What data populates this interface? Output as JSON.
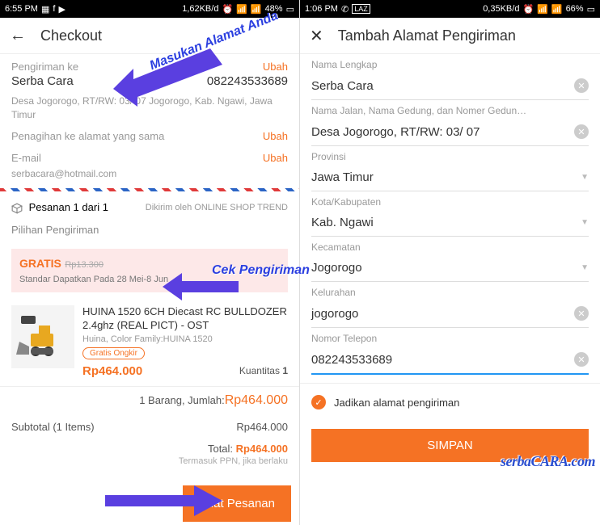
{
  "left": {
    "status": {
      "time": "6:55 PM",
      "net": "1,62KB/d",
      "batt": "48%"
    },
    "title": "Checkout",
    "ship_to_label": "Pengiriman ke",
    "ubah": "Ubah",
    "name": "Serba Cara",
    "phone": "082243533689",
    "address": "Desa Jogorogo, RT/RW: 03/ 07 Jogorogo, Kab. Ngawi, Jawa Timur",
    "billing_label": "Penagihan ke alamat yang sama",
    "email_label": "E-mail",
    "email": "serbacara@hotmail.com",
    "order_label": "Pesanan 1 dari 1",
    "shipped_by": "Dikirim oleh ONLINE SHOP TREND",
    "ship_option_label": "Pilihan Pengiriman",
    "free": "GRATIS",
    "free_strike": "Rp13.300",
    "ship_sub": "Standar  Dapatkan Pada 28 Mei-8 Jun",
    "product": {
      "title": "HUINA 1520 6CH Diecast RC BULLDOZER 2.4ghz (REAL PICT) - OST",
      "meta": "Huina, Color Family:HUINA 1520",
      "badge": "Gratis Ongkir",
      "price": "Rp464.000",
      "qty_label": "Kuantitas",
      "qty": "1"
    },
    "sum_label": "1 Barang, Jumlah:",
    "sum_amt": "Rp464.000",
    "subtotal_label": "Subtotal  (1 Items)",
    "subtotal": "Rp464.000",
    "total_label": "Total:",
    "total": "Rp464.000",
    "ppn": "Termasuk PPN, jika berlaku",
    "cta": "Buat Pesanan"
  },
  "right": {
    "status": {
      "time": "1:06 PM",
      "net": "0,35KB/d",
      "batt": "66%"
    },
    "title": "Tambah Alamat Pengiriman",
    "fields": {
      "nama_label": "Nama Lengkap",
      "nama": "Serba Cara",
      "jalan_label": "Nama Jalan, Nama Gedung, dan Nomer Gedun…",
      "jalan": "Desa Jogorogo, RT/RW: 03/ 07",
      "prov_label": "Provinsi",
      "prov": "Jawa Timur",
      "kota_label": "Kota/Kabupaten",
      "kota": "Kab. Ngawi",
      "kec_label": "Kecamatan",
      "kec": "Jogorogo",
      "kel_label": "Kelurahan",
      "kel": "jogorogo",
      "tel_label": "Nomor Telepon",
      "tel": "082243533689"
    },
    "chk": "Jadikan alamat pengiriman",
    "save": "SIMPAN"
  },
  "annotations": {
    "a1": "Masukan Alamat Anda",
    "a2": "Cek Pengiriman",
    "watermark": "serbaCARA.com"
  }
}
